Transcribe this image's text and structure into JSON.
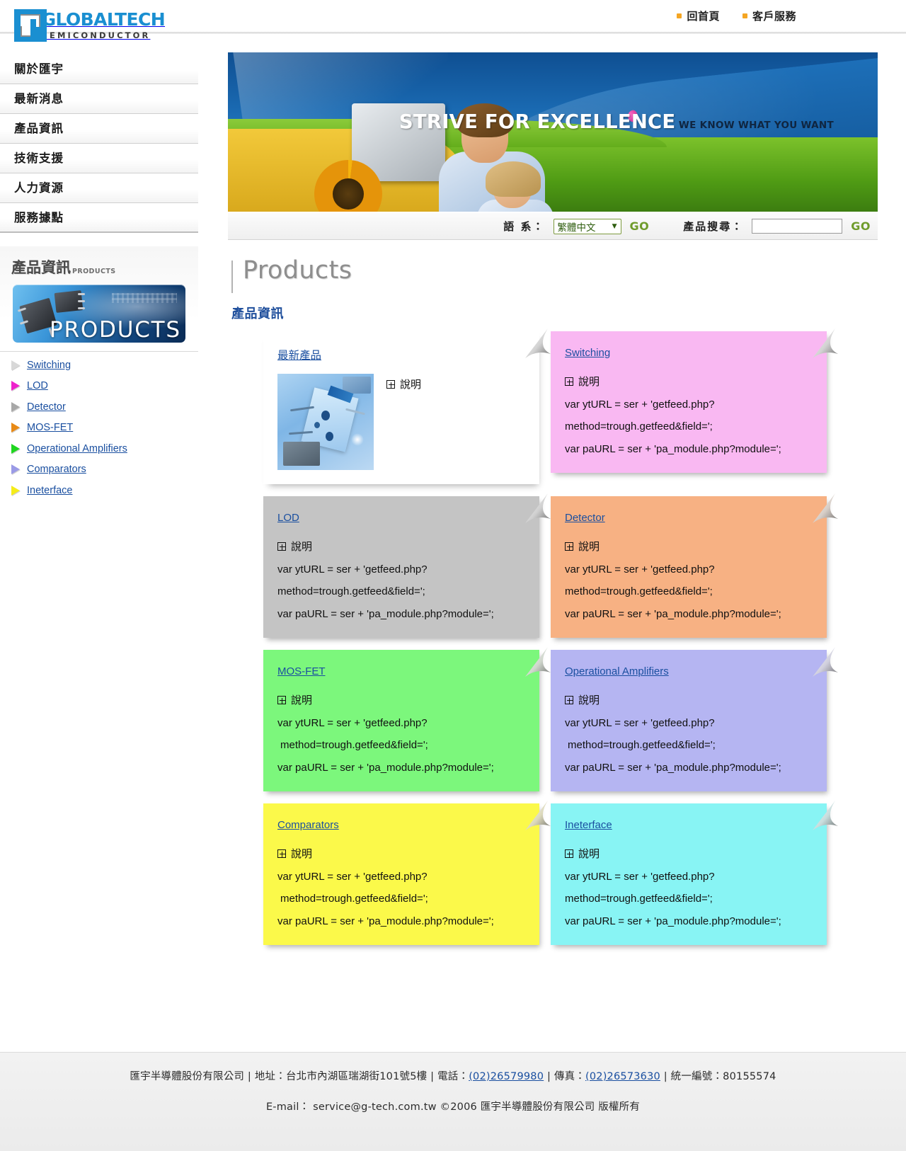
{
  "top_links": [
    {
      "label": "回首頁",
      "icon": "bullet-square-icon"
    },
    {
      "label": "客戶服務",
      "icon": "bullet-square-icon"
    }
  ],
  "logo": {
    "line1": "GLOBALTECH",
    "line2": "SEMICONDUCTOR",
    "brand_color": "#1a8fd1"
  },
  "main_nav": [
    {
      "label": "關於匯宇"
    },
    {
      "label": "最新消息"
    },
    {
      "label": "產品資訊"
    },
    {
      "label": "技術支援"
    },
    {
      "label": "人力資源"
    },
    {
      "label": "服務據點"
    }
  ],
  "products_panel": {
    "heading_cn": "產品資訊",
    "heading_en": "PRODUCTS",
    "banner_word": "PRODUCTS"
  },
  "product_links": [
    {
      "label": "Switching",
      "arrow_color": "#d8d8d8"
    },
    {
      "label": "LOD",
      "arrow_color": "#ee22cc"
    },
    {
      "label": "Detector",
      "arrow_color": "#a8a8a8"
    },
    {
      "label": "MOS-FET",
      "arrow_color": "#e88a16"
    },
    {
      "label": "Operational Amplifiers",
      "arrow_color": "#1fd61f"
    },
    {
      "label": "Comparators",
      "arrow_color": "#9a9ae6"
    },
    {
      "label": "Ineterface",
      "arrow_color": "#f5ec1a"
    }
  ],
  "banner": {
    "headline": "STRIVE FOR EXCELLENCE",
    "subhead": "WE KNOW  WHAT YOU WANT"
  },
  "searchbar": {
    "lang_label": "語 系：",
    "lang_selected": "繁體中文",
    "lang_go": "GO",
    "search_label": "產品搜尋：",
    "search_value": "",
    "search_placeholder": "",
    "search_go": "GO",
    "accent_color": "#6f9b2b"
  },
  "page": {
    "title": "Products",
    "subtitle": "產品資訊"
  },
  "cards": [
    {
      "title": "最新產品",
      "title_is_cjk": true,
      "bg": "#ffffff",
      "kind": "featured",
      "desc_label": "說明"
    },
    {
      "title": "Switching",
      "title_is_cjk": false,
      "bg": "#f9b8f2",
      "kind": "code",
      "desc_label": "說明",
      "code": [
        "var ytURL = ser + 'getfeed.php?",
        "method=trough.getfeed&field=';",
        "var paURL = ser + 'pa_module.php?module=';"
      ]
    },
    {
      "title": "LOD",
      "title_is_cjk": false,
      "bg": "#c4c4c4",
      "kind": "code",
      "desc_label": "說明",
      "code": [
        "var ytURL = ser + 'getfeed.php?",
        "method=trough.getfeed&field=';",
        "var paURL = ser + 'pa_module.php?module=';"
      ]
    },
    {
      "title": "Detector",
      "title_is_cjk": false,
      "bg": "#f7b183",
      "kind": "code",
      "desc_label": "說明",
      "code": [
        "var ytURL = ser + 'getfeed.php?",
        "method=trough.getfeed&field=';",
        "var paURL = ser + 'pa_module.php?module=';"
      ]
    },
    {
      "title": "MOS-FET",
      "title_is_cjk": false,
      "bg": "#7cf77c",
      "kind": "code",
      "desc_label": "說明",
      "code": [
        "var ytURL = ser + 'getfeed.php?",
        "method=trough.getfeed&field=';",
        "var paURL = ser + 'pa_module.php?module=';"
      ]
    },
    {
      "title": "Operational Amplifiers",
      "title_is_cjk": false,
      "bg": "#b5b5f2",
      "kind": "code",
      "desc_label": "說明",
      "code": [
        "var ytURL = ser + 'getfeed.php?",
        "method=trough.getfeed&field=';",
        "var paURL = ser + 'pa_module.php?module=';"
      ]
    },
    {
      "title": "Comparators",
      "title_is_cjk": false,
      "bg": "#fbf94a",
      "kind": "code",
      "desc_label": "說明",
      "code": [
        "var ytURL = ser + 'getfeed.php?",
        "method=trough.getfeed&field=';",
        "var paURL = ser + 'pa_module.php?module=';"
      ]
    },
    {
      "title": "Ineterface",
      "title_is_cjk": false,
      "bg": "#88f4f4",
      "kind": "code",
      "desc_label": "說明",
      "code": [
        "var ytURL = ser + 'getfeed.php?",
        "method=trough.getfeed&field=';",
        "var paURL = ser + 'pa_module.php?module=';"
      ]
    }
  ],
  "footer": {
    "company": "匯宇半導體股份有限公司",
    "sep1": " | ",
    "address_label": "地址：",
    "address": "台北市內湖區瑞湖街101號5樓",
    "sep2": " | ",
    "tel_label": "電話：",
    "tel": "(02)26579980",
    "sep3": " | ",
    "fax_label": "傳真：",
    "fax": "(02)26573630",
    "sep4": " | ",
    "tax_label": "統一編號：",
    "tax_id": "80155574",
    "email_label": "E-mail：",
    "email": "service@g-tech.com.tw",
    "copyright": "©2006 匯宇半導體股份有限公司 版權所有"
  }
}
